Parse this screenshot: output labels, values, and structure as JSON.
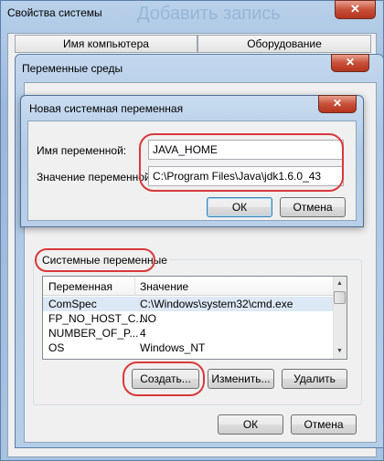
{
  "sys_props": {
    "title": "Свойства системы",
    "background_title": "Добавить запись",
    "tabs": [
      "Имя компьютера",
      "Оборудование"
    ],
    "close_label": "✕"
  },
  "env_vars": {
    "title": "Переменные среды",
    "close_label": "✕",
    "system_vars_label": "Системные переменные",
    "columns": [
      "Переменная",
      "Значение"
    ],
    "rows": [
      {
        "name": "ComSpec",
        "value": "C:\\Windows\\system32\\cmd.exe"
      },
      {
        "name": "FP_NO_HOST_C...",
        "value": "NO"
      },
      {
        "name": "NUMBER_OF_P...",
        "value": "4"
      },
      {
        "name": "OS",
        "value": "Windows_NT"
      }
    ],
    "create_label": "Создать...",
    "edit_label": "Изменить...",
    "delete_label": "Удалить",
    "ok_label": "ОК",
    "cancel_label": "Отмена"
  },
  "new_var_dialog": {
    "title": "Новая системная переменная",
    "close_label": "✕",
    "name_label": "Имя переменной:",
    "value_label": "Значение переменной:",
    "name_value": "JAVA_HOME",
    "value_value": "C:\\Program Files\\Java\\jdk1.6.0_43",
    "ok_label": "ОК",
    "cancel_label": "Отмена"
  },
  "colors": {
    "highlight_oval": "#d9383a",
    "selected_row": "#dde8f5"
  }
}
